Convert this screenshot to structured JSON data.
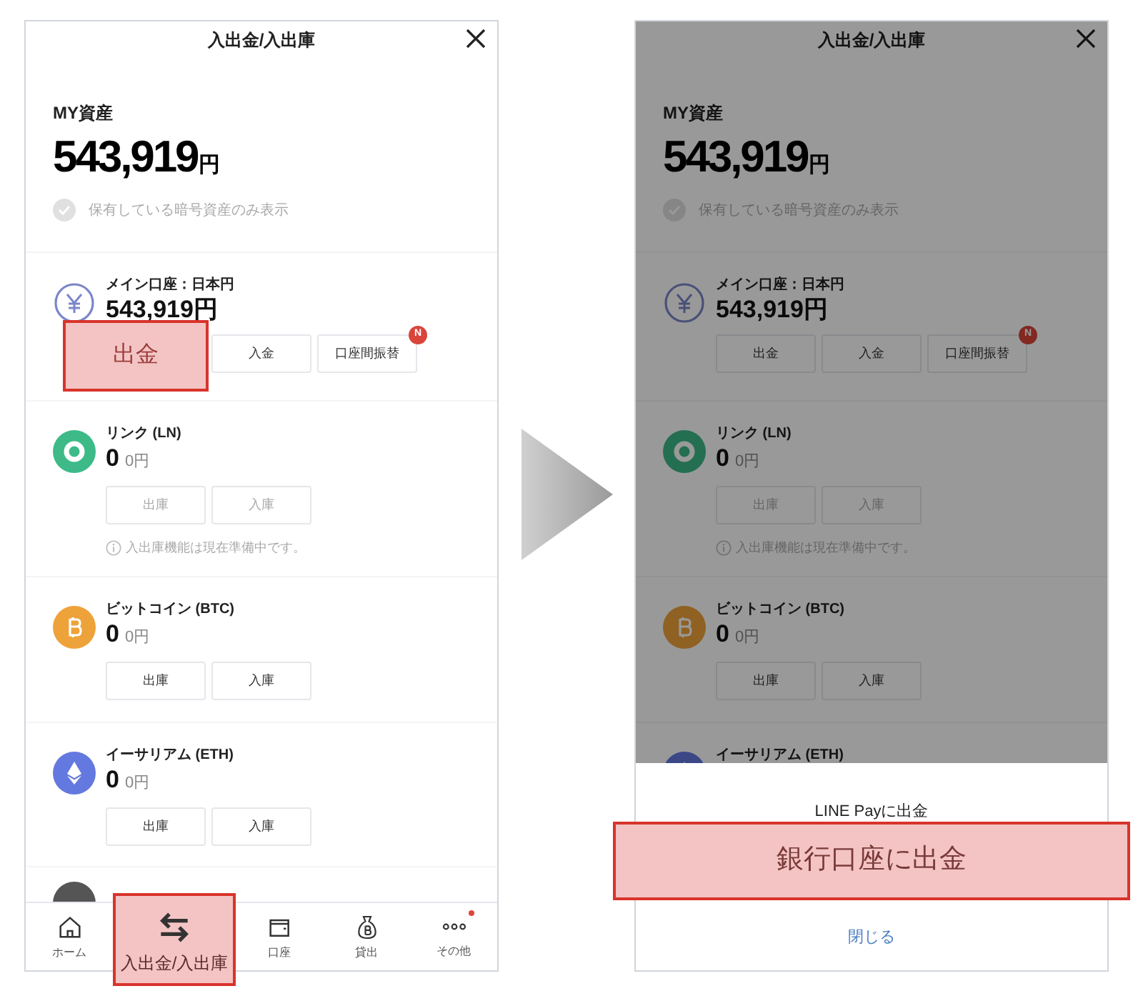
{
  "screens": [
    {
      "dimmed": false,
      "header": {
        "title": "入出金/入出庫"
      },
      "total": {
        "label": "MY資産",
        "amount": "543,919",
        "unit": "円"
      },
      "filter": {
        "label": "保有している暗号資産のみ表示",
        "checked": false
      },
      "accounts": [
        {
          "kind": "fiat",
          "name": "メイン口座：日本円",
          "amount": "543,919円",
          "buttons": [
            {
              "label": "出金",
              "highlighted": true,
              "disabled": false
            },
            {
              "label": "入金",
              "highlighted": false,
              "disabled": false
            },
            {
              "label": "口座間振替",
              "highlighted": false,
              "disabled": false,
              "badge": "N"
            }
          ]
        },
        {
          "kind": "link",
          "name": "リンク (LN)",
          "amount": "0",
          "value": "0円",
          "buttons": [
            {
              "label": "出庫",
              "highlighted": false,
              "disabled": true
            },
            {
              "label": "入庫",
              "highlighted": false,
              "disabled": true
            }
          ],
          "note": "入出庫機能は現在準備中です。"
        },
        {
          "kind": "bitcoin",
          "name": "ビットコイン (BTC)",
          "amount": "0",
          "value": "0円",
          "buttons": [
            {
              "label": "出庫",
              "highlighted": false,
              "disabled": false
            },
            {
              "label": "入庫",
              "highlighted": false,
              "disabled": false
            }
          ]
        },
        {
          "kind": "ethereum",
          "name": "イーサリアム (ETH)",
          "amount": "0",
          "value": "0円",
          "buttons": [
            {
              "label": "出庫",
              "highlighted": false,
              "disabled": false
            },
            {
              "label": "入庫",
              "highlighted": false,
              "disabled": false
            }
          ]
        },
        {
          "kind": "partial"
        }
      ],
      "nav": [
        {
          "kind": "home",
          "label": "ホーム",
          "selected": false,
          "highlighted": false
        },
        {
          "kind": "transfer",
          "label": "入出金/入出庫",
          "selected": true,
          "highlighted": true
        },
        {
          "kind": "wallet",
          "label": "口座",
          "selected": false,
          "highlighted": false
        },
        {
          "kind": "loan",
          "label": "貸出",
          "selected": false,
          "highlighted": false
        },
        {
          "kind": "more",
          "label": "その他",
          "selected": false,
          "highlighted": false,
          "dot": true
        }
      ]
    },
    {
      "dimmed": true,
      "header": {
        "title": "入出金/入出庫"
      },
      "total": {
        "label": "MY資産",
        "amount": "543,919",
        "unit": "円"
      },
      "filter": {
        "label": "保有している暗号資産のみ表示",
        "checked": false
      },
      "accounts": [
        {
          "kind": "fiat",
          "name": "メイン口座：日本円",
          "amount": "543,919円",
          "buttons": [
            {
              "label": "出金",
              "highlighted": false,
              "disabled": false
            },
            {
              "label": "入金",
              "highlighted": false,
              "disabled": false
            },
            {
              "label": "口座間振替",
              "highlighted": false,
              "disabled": false,
              "badge": "N"
            }
          ]
        },
        {
          "kind": "link",
          "name": "リンク (LN)",
          "amount": "0",
          "value": "0円",
          "buttons": [
            {
              "label": "出庫",
              "highlighted": false,
              "disabled": true
            },
            {
              "label": "入庫",
              "highlighted": false,
              "disabled": true
            }
          ],
          "note": "入出庫機能は現在準備中です。"
        },
        {
          "kind": "bitcoin",
          "name": "ビットコイン (BTC)",
          "amount": "0",
          "value": "0円",
          "buttons": [
            {
              "label": "出庫",
              "highlighted": false,
              "disabled": false
            },
            {
              "label": "入庫",
              "highlighted": false,
              "disabled": false
            }
          ]
        },
        {
          "kind": "ethereum",
          "name": "イーサリアム (ETH)"
        }
      ],
      "sheet": {
        "options": [
          {
            "label": "LINE Payに出金",
            "highlighted": false
          },
          {
            "label": "銀行口座に出金",
            "highlighted": true
          }
        ],
        "close": "閉じる"
      }
    }
  ]
}
